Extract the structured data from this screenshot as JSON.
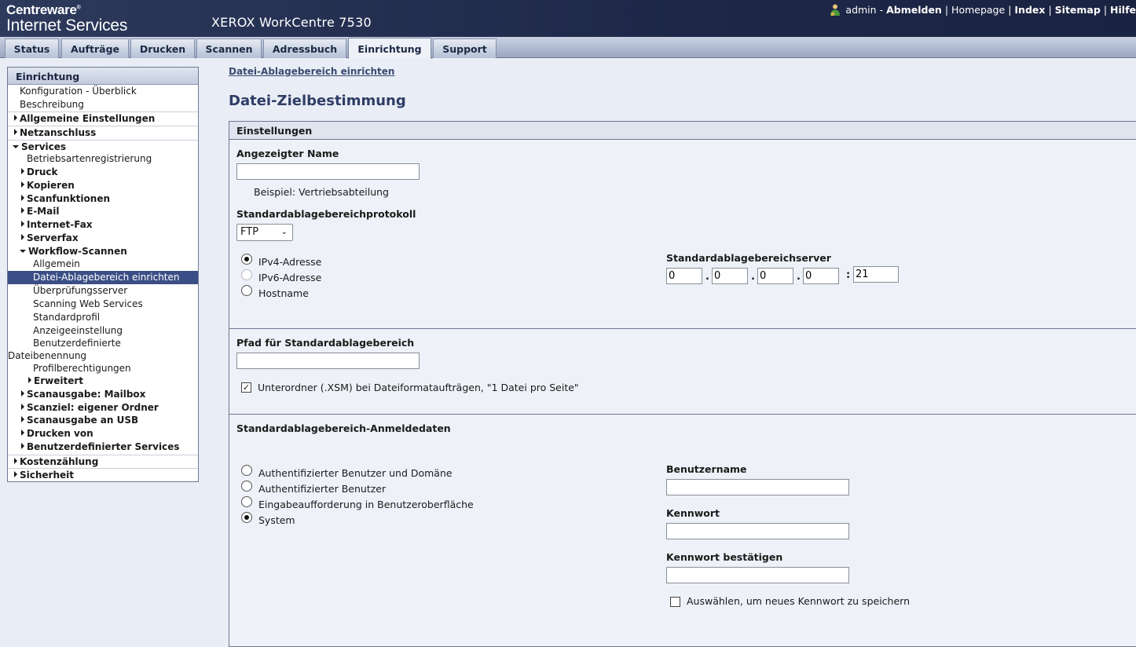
{
  "header": {
    "brand_line1": "Centreware",
    "brand_reg": "®",
    "brand_line2": "Internet Services",
    "product": "XEROX WorkCentre 7530",
    "links": {
      "user": "admin",
      "dash": "-",
      "logout": "Abmelden",
      "home": "Homepage",
      "index": "Index",
      "sitemap": "Sitemap",
      "help": "Hilfe"
    }
  },
  "tabs": [
    {
      "label": "Status"
    },
    {
      "label": "Aufträge"
    },
    {
      "label": "Drucken"
    },
    {
      "label": "Scannen"
    },
    {
      "label": "Adressbuch"
    },
    {
      "label": "Einrichtung"
    },
    {
      "label": "Support"
    }
  ],
  "sidebar": {
    "title": "Einrichtung",
    "items": [
      {
        "label": "Konfiguration - Überblick"
      },
      {
        "label": "Beschreibung"
      },
      {
        "label": "Allgemeine Einstellungen"
      },
      {
        "label": "Netzanschluss"
      },
      {
        "label": "Services"
      },
      {
        "label": "Betriebsartenregistrierung"
      },
      {
        "label": "Druck"
      },
      {
        "label": "Kopieren"
      },
      {
        "label": "Scanfunktionen"
      },
      {
        "label": "E-Mail"
      },
      {
        "label": "Internet-Fax"
      },
      {
        "label": "Serverfax"
      },
      {
        "label": "Workflow-Scannen"
      },
      {
        "label": "Allgemein"
      },
      {
        "label": "Datei-Ablagebereich einrichten"
      },
      {
        "label": "Überprüfungsserver"
      },
      {
        "label": "Scanning Web Services"
      },
      {
        "label": "Standardprofil"
      },
      {
        "label": "Anzeigeeinstellung"
      },
      {
        "label": "Benutzerdefinierte"
      },
      {
        "label": "Dateibenennung"
      },
      {
        "label": "Profilberechtigungen"
      },
      {
        "label": "Erweitert"
      },
      {
        "label": "Scanausgabe: Mailbox"
      },
      {
        "label": "Scanziel: eigener Ordner"
      },
      {
        "label": "Scanausgabe an USB"
      },
      {
        "label": "Drucken von"
      },
      {
        "label": "Benutzerdefinierter Services"
      },
      {
        "label": "Kostenzählung"
      },
      {
        "label": "Sicherheit"
      }
    ]
  },
  "main": {
    "breadcrumb": "Datei-Ablagebereich einrichten",
    "title": "Datei-Zielbestimmung",
    "panel_title": "Einstellungen",
    "display_name_label": "Angezeigter Name",
    "display_name_value": "",
    "example": "Beispiel: Vertriebsabteilung",
    "protocol_label": "Standardablagebereichprotokoll",
    "protocol_value": "FTP",
    "address_options": [
      "IPv4-Adresse",
      "IPv6-Adresse",
      "Hostname"
    ],
    "server_label": "Standardablagebereichserver",
    "ip": [
      "0",
      "0",
      "0",
      "0"
    ],
    "ip_dot": ".",
    "port_sep": ":",
    "port": "21",
    "path_label": "Pfad für Standardablagebereich",
    "path_value": "",
    "subfolder_label": "Unterordner (.XSM) bei Dateiformataufträgen, \"1 Datei pro Seite\"",
    "subfolder_check": "✓",
    "credentials_label": "Standardablagebereich-Anmeldedaten",
    "credential_options": [
      "Authentifizierter Benutzer und Domäne",
      "Authentifizierter Benutzer",
      "Eingabeaufforderung in Benutzeroberfläche",
      "System"
    ],
    "username_label": "Benutzername",
    "password_label": "Kennwort",
    "password_confirm_label": "Kennwort bestätigen",
    "save_password_label": "Auswählen, um neues Kennwort zu speichern"
  }
}
